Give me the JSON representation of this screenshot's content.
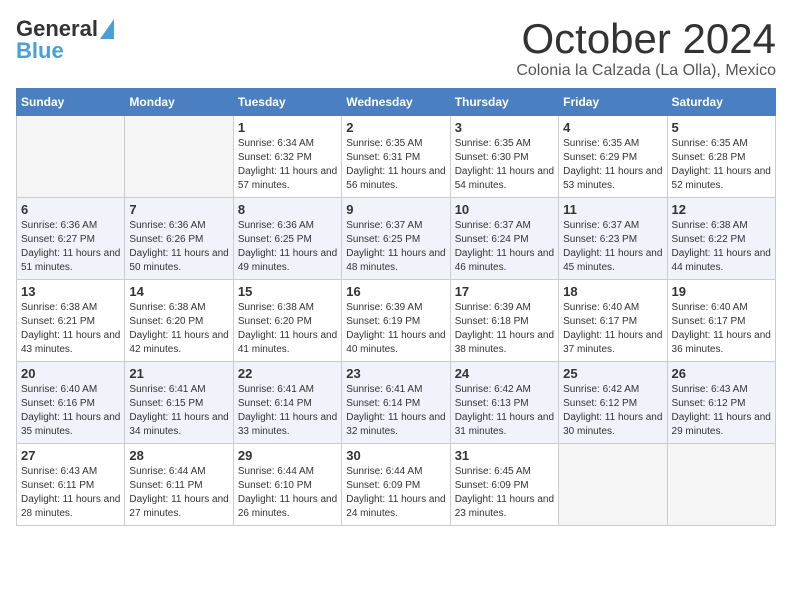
{
  "header": {
    "logo_line1": "General",
    "logo_line2": "Blue",
    "month_title": "October 2024",
    "location": "Colonia la Calzada (La Olla), Mexico"
  },
  "weekdays": [
    "Sunday",
    "Monday",
    "Tuesday",
    "Wednesday",
    "Thursday",
    "Friday",
    "Saturday"
  ],
  "weeks": [
    [
      {
        "day": "",
        "empty": true
      },
      {
        "day": "",
        "empty": true
      },
      {
        "day": "1",
        "sunrise": "6:34 AM",
        "sunset": "6:32 PM",
        "daylight": "11 hours and 57 minutes."
      },
      {
        "day": "2",
        "sunrise": "6:35 AM",
        "sunset": "6:31 PM",
        "daylight": "11 hours and 56 minutes."
      },
      {
        "day": "3",
        "sunrise": "6:35 AM",
        "sunset": "6:30 PM",
        "daylight": "11 hours and 54 minutes."
      },
      {
        "day": "4",
        "sunrise": "6:35 AM",
        "sunset": "6:29 PM",
        "daylight": "11 hours and 53 minutes."
      },
      {
        "day": "5",
        "sunrise": "6:35 AM",
        "sunset": "6:28 PM",
        "daylight": "11 hours and 52 minutes."
      }
    ],
    [
      {
        "day": "6",
        "sunrise": "6:36 AM",
        "sunset": "6:27 PM",
        "daylight": "11 hours and 51 minutes."
      },
      {
        "day": "7",
        "sunrise": "6:36 AM",
        "sunset": "6:26 PM",
        "daylight": "11 hours and 50 minutes."
      },
      {
        "day": "8",
        "sunrise": "6:36 AM",
        "sunset": "6:25 PM",
        "daylight": "11 hours and 49 minutes."
      },
      {
        "day": "9",
        "sunrise": "6:37 AM",
        "sunset": "6:25 PM",
        "daylight": "11 hours and 48 minutes."
      },
      {
        "day": "10",
        "sunrise": "6:37 AM",
        "sunset": "6:24 PM",
        "daylight": "11 hours and 46 minutes."
      },
      {
        "day": "11",
        "sunrise": "6:37 AM",
        "sunset": "6:23 PM",
        "daylight": "11 hours and 45 minutes."
      },
      {
        "day": "12",
        "sunrise": "6:38 AM",
        "sunset": "6:22 PM",
        "daylight": "11 hours and 44 minutes."
      }
    ],
    [
      {
        "day": "13",
        "sunrise": "6:38 AM",
        "sunset": "6:21 PM",
        "daylight": "11 hours and 43 minutes."
      },
      {
        "day": "14",
        "sunrise": "6:38 AM",
        "sunset": "6:20 PM",
        "daylight": "11 hours and 42 minutes."
      },
      {
        "day": "15",
        "sunrise": "6:38 AM",
        "sunset": "6:20 PM",
        "daylight": "11 hours and 41 minutes."
      },
      {
        "day": "16",
        "sunrise": "6:39 AM",
        "sunset": "6:19 PM",
        "daylight": "11 hours and 40 minutes."
      },
      {
        "day": "17",
        "sunrise": "6:39 AM",
        "sunset": "6:18 PM",
        "daylight": "11 hours and 38 minutes."
      },
      {
        "day": "18",
        "sunrise": "6:40 AM",
        "sunset": "6:17 PM",
        "daylight": "11 hours and 37 minutes."
      },
      {
        "day": "19",
        "sunrise": "6:40 AM",
        "sunset": "6:17 PM",
        "daylight": "11 hours and 36 minutes."
      }
    ],
    [
      {
        "day": "20",
        "sunrise": "6:40 AM",
        "sunset": "6:16 PM",
        "daylight": "11 hours and 35 minutes."
      },
      {
        "day": "21",
        "sunrise": "6:41 AM",
        "sunset": "6:15 PM",
        "daylight": "11 hours and 34 minutes."
      },
      {
        "day": "22",
        "sunrise": "6:41 AM",
        "sunset": "6:14 PM",
        "daylight": "11 hours and 33 minutes."
      },
      {
        "day": "23",
        "sunrise": "6:41 AM",
        "sunset": "6:14 PM",
        "daylight": "11 hours and 32 minutes."
      },
      {
        "day": "24",
        "sunrise": "6:42 AM",
        "sunset": "6:13 PM",
        "daylight": "11 hours and 31 minutes."
      },
      {
        "day": "25",
        "sunrise": "6:42 AM",
        "sunset": "6:12 PM",
        "daylight": "11 hours and 30 minutes."
      },
      {
        "day": "26",
        "sunrise": "6:43 AM",
        "sunset": "6:12 PM",
        "daylight": "11 hours and 29 minutes."
      }
    ],
    [
      {
        "day": "27",
        "sunrise": "6:43 AM",
        "sunset": "6:11 PM",
        "daylight": "11 hours and 28 minutes."
      },
      {
        "day": "28",
        "sunrise": "6:44 AM",
        "sunset": "6:11 PM",
        "daylight": "11 hours and 27 minutes."
      },
      {
        "day": "29",
        "sunrise": "6:44 AM",
        "sunset": "6:10 PM",
        "daylight": "11 hours and 26 minutes."
      },
      {
        "day": "30",
        "sunrise": "6:44 AM",
        "sunset": "6:09 PM",
        "daylight": "11 hours and 24 minutes."
      },
      {
        "day": "31",
        "sunrise": "6:45 AM",
        "sunset": "6:09 PM",
        "daylight": "11 hours and 23 minutes."
      },
      {
        "day": "",
        "empty": true
      },
      {
        "day": "",
        "empty": true
      }
    ]
  ]
}
